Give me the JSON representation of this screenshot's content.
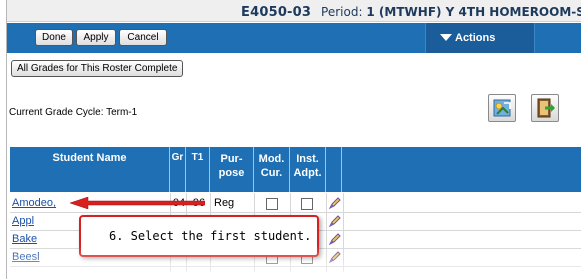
{
  "header": {
    "section": "E4050-03",
    "period_label": "Period:",
    "period_value": "1 (MTWHF) Y 4TH HOMEROOM-S"
  },
  "toolbar": {
    "done_label": "Done",
    "apply_label": "Apply",
    "cancel_label": "Cancel",
    "actions_label": "Actions"
  },
  "complete_button_label": "All Grades for This Roster Complete",
  "grade_cycle": "Current Grade Cycle: Term-1",
  "grid": {
    "columns": {
      "name": "Student Name",
      "gr": "Gr",
      "t1": "T1",
      "purpose_1": "Pur-",
      "purpose_2": "pose",
      "mod_1": "Mod.",
      "mod_2": "Cur.",
      "inst_1": "Inst.",
      "inst_2": "Adpt."
    },
    "rows": [
      {
        "name": "Amodeo,",
        "gr": "04",
        "t1": "96",
        "purpose": "Reg"
      },
      {
        "name": "Appl",
        "gr": "",
        "t1": "",
        "purpose": ""
      },
      {
        "name": "Bake",
        "gr": "",
        "t1": "",
        "purpose": ""
      },
      {
        "name": "Beesl",
        "gr": "",
        "t1": "",
        "purpose": ""
      }
    ]
  },
  "callout": {
    "text": "6.  Select the first student."
  },
  "colors": {
    "header_blue": "#1e6fb4",
    "callout_red": "#d92020",
    "link_blue": "#1a4fa8"
  },
  "icons": [
    "triangle-down-icon",
    "export-icon",
    "exit-icon",
    "edit-pencil-icon",
    "arrow-left-icon"
  ]
}
